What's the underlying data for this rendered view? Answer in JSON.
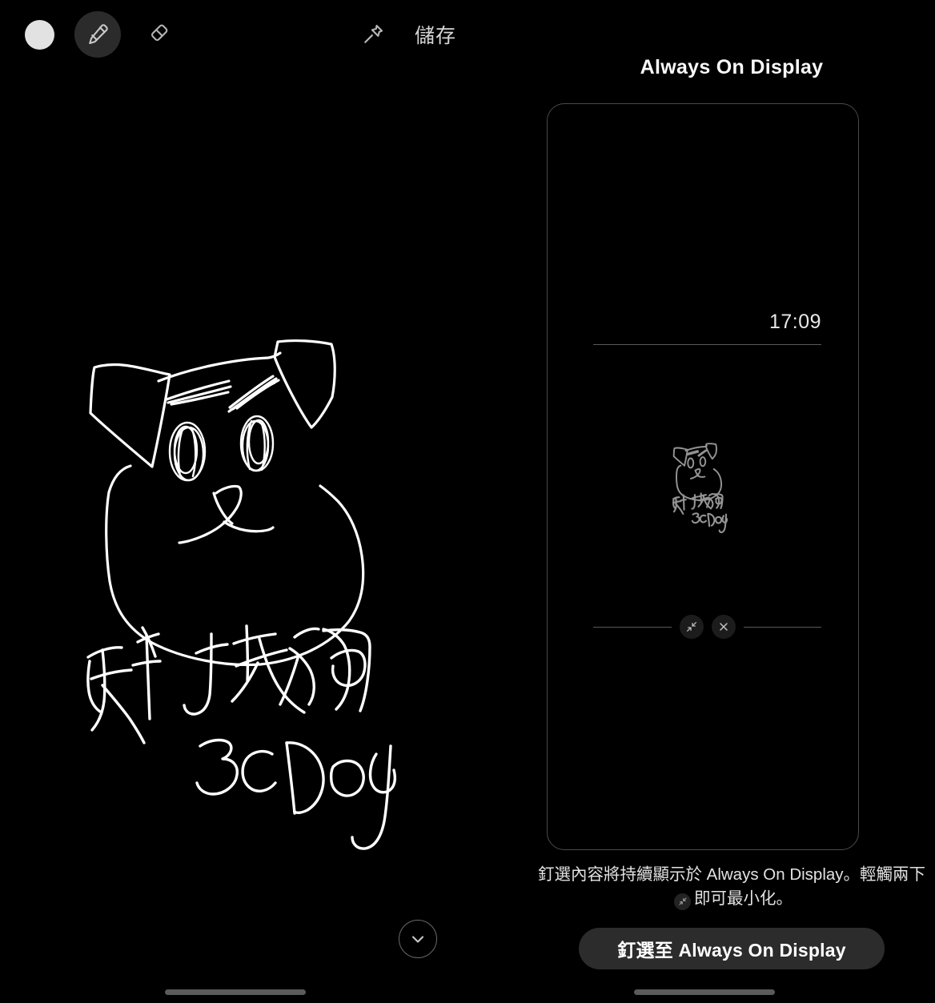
{
  "toolbar": {
    "color_swatch": {
      "name": "white",
      "hex": "#e2e2e2"
    },
    "pen_tool_label": "pen",
    "eraser_tool_label": "eraser",
    "pin_icon_label": "pin",
    "save_label": "儲存"
  },
  "canvas": {
    "drawing_description": "手繪狗頭",
    "handwriting_line1": "科技狗",
    "handwriting_line2": "3cDog",
    "stroke_color": "#ffffff",
    "collapse_label": "收合"
  },
  "aod": {
    "title": "Always On Display",
    "clock": "17:09",
    "minimize_label": "最小化",
    "close_label": "關閉",
    "description_part1": "釘選內容將持續顯示於 Always On Display。輕觸兩下",
    "description_part2": "即可最小化。",
    "cta_label": "釘選至 Always On Display",
    "preview_handwriting_line1": "科技狗",
    "preview_handwriting_line2": "3cDog"
  }
}
